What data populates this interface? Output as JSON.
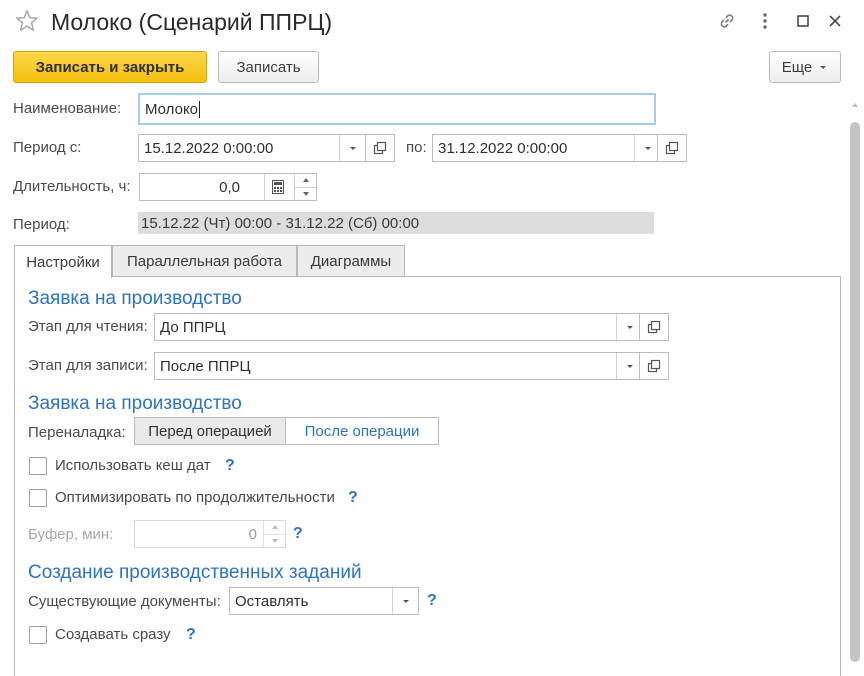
{
  "window": {
    "title": "Молоко (Сценарий ППРЦ)"
  },
  "toolbar": {
    "save_close_label": "Записать и закрыть",
    "save_label": "Записать",
    "more_label": "Еще"
  },
  "form": {
    "name_label": "Наименование:",
    "name_value": "Молоко",
    "period_from_label": "Период с:",
    "period_from_value": "15.12.2022 0:00:00",
    "period_to_label": "по:",
    "period_to_value": "31.12.2022 0:00:00",
    "duration_label": "Длительность, ч:",
    "duration_value": "0,0",
    "period_label": "Период:",
    "period_value": "15.12.22 (Чт) 00:00 - 31.12.22 (Сб) 00:00"
  },
  "tabs": [
    {
      "label": "Настройки",
      "active": true
    },
    {
      "label": "Параллельная работа",
      "active": false
    },
    {
      "label": "Диаграммы",
      "active": false
    }
  ],
  "settings": {
    "group1_title": "Заявка на производство",
    "read_stage_label": "Этап для чтения:",
    "read_stage_value": "До ППРЦ",
    "write_stage_label": "Этап для записи:",
    "write_stage_value": "После ППРЦ",
    "group2_title": "Заявка на производство",
    "changeover_label": "Переналадка:",
    "changeover_options": [
      "Перед операцией",
      "После операции"
    ],
    "changeover_selected": "Перед операцией",
    "use_cache_label": "Использовать кеш дат",
    "use_cache_checked": false,
    "optimize_label": "Оптимизировать по продолжительности",
    "optimize_checked": false,
    "buffer_label": "Буфер, мин:",
    "buffer_value": "0",
    "help_mark": "?",
    "group3_title": "Создание производственных заданий",
    "existing_docs_label": "Существующие документы:",
    "existing_docs_value": "Оставлять",
    "create_now_label": "Создавать сразу",
    "create_now_checked": false
  },
  "colors": {
    "accent": "#2c73c0",
    "primary_button": "#f4bf0e",
    "focus_border": "#a4cdef"
  },
  "icons": [
    "star-icon",
    "link-icon",
    "more-vertical-icon",
    "maximize-icon",
    "close-icon",
    "chevron-down-icon",
    "open-icon",
    "calculator-icon",
    "spin-up-icon",
    "spin-down-icon"
  ]
}
